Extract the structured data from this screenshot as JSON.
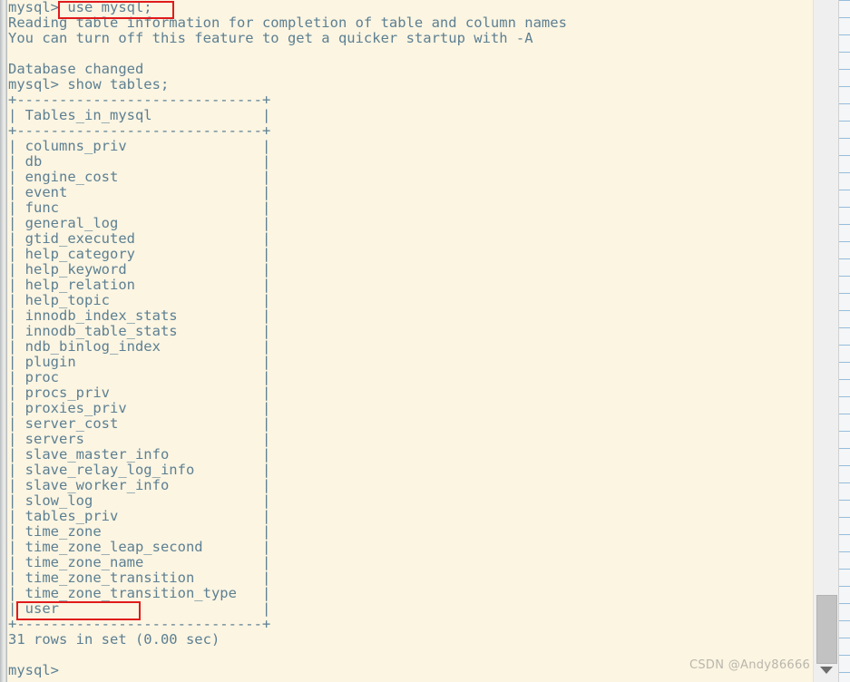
{
  "window": {
    "kind": "mysql-client-terminal",
    "background_color": "#fbf5e2",
    "text_color": "#5d7f92",
    "annotation_color": "#e01b1b"
  },
  "terminal": {
    "prompt": "mysql>",
    "lines": [
      "mysql> use mysql;",
      "Reading table information for completion of table and column names",
      "You can turn off this feature to get a quicker startup with -A",
      "",
      "Database changed",
      "mysql> show tables;",
      "+-----------------------------+",
      "| Tables_in_mysql             |",
      "+-----------------------------+",
      "| columns_priv                |",
      "| db                          |",
      "| engine_cost                 |",
      "| event                       |",
      "| func                        |",
      "| general_log                 |",
      "| gtid_executed               |",
      "| help_category               |",
      "| help_keyword                |",
      "| help_relation               |",
      "| help_topic                  |",
      "| innodb_index_stats          |",
      "| innodb_table_stats          |",
      "| ndb_binlog_index            |",
      "| plugin                      |",
      "| proc                        |",
      "| procs_priv                  |",
      "| proxies_priv                |",
      "| server_cost                 |",
      "| servers                     |",
      "| slave_master_info           |",
      "| slave_relay_log_info        |",
      "| slave_worker_info           |",
      "| slow_log                    |",
      "| tables_priv                 |",
      "| time_zone                   |",
      "| time_zone_leap_second       |",
      "| time_zone_name              |",
      "| time_zone_transition        |",
      "| time_zone_transition_type   |",
      "| user                        |",
      "+-----------------------------+",
      "31 rows in set (0.00 sec)",
      "",
      "mysql> "
    ],
    "commands": {
      "use_database": "use mysql;",
      "show_tables": "show tables;"
    },
    "messages": {
      "reading_table_info": "Reading table information for completion of table and column names",
      "turn_off_hint": "You can turn off this feature to get a quicker startup with -A",
      "database_changed": "Database changed",
      "row_count": "31 rows in set (0.00 sec)"
    },
    "result_table": {
      "column_header": "Tables_in_mysql",
      "separator": "+-----------------------------+",
      "row_count_label": "31 rows in set (0.00 sec)",
      "rows": [
        "columns_priv",
        "db",
        "engine_cost",
        "event",
        "func",
        "general_log",
        "gtid_executed",
        "help_category",
        "help_keyword",
        "help_relation",
        "help_topic",
        "innodb_index_stats",
        "innodb_table_stats",
        "ndb_binlog_index",
        "plugin",
        "proc",
        "procs_priv",
        "proxies_priv",
        "server_cost",
        "servers",
        "slave_master_info",
        "slave_relay_log_info",
        "slave_worker_info",
        "slow_log",
        "tables_priv",
        "time_zone",
        "time_zone_leap_second",
        "time_zone_name",
        "time_zone_transition",
        "time_zone_transition_type",
        "user"
      ]
    }
  },
  "annotations": [
    {
      "id": "use-mysql",
      "target_text": "use mysql;",
      "color": "#e01b1b"
    },
    {
      "id": "user-row",
      "target_text": "user",
      "color": "#e01b1b"
    }
  ],
  "scrollbar": {
    "orientation": "vertical",
    "thumb_position": "bottom",
    "down_arrow_glyph": "▼"
  },
  "watermark": {
    "text": "CSDN @Andy86666"
  }
}
